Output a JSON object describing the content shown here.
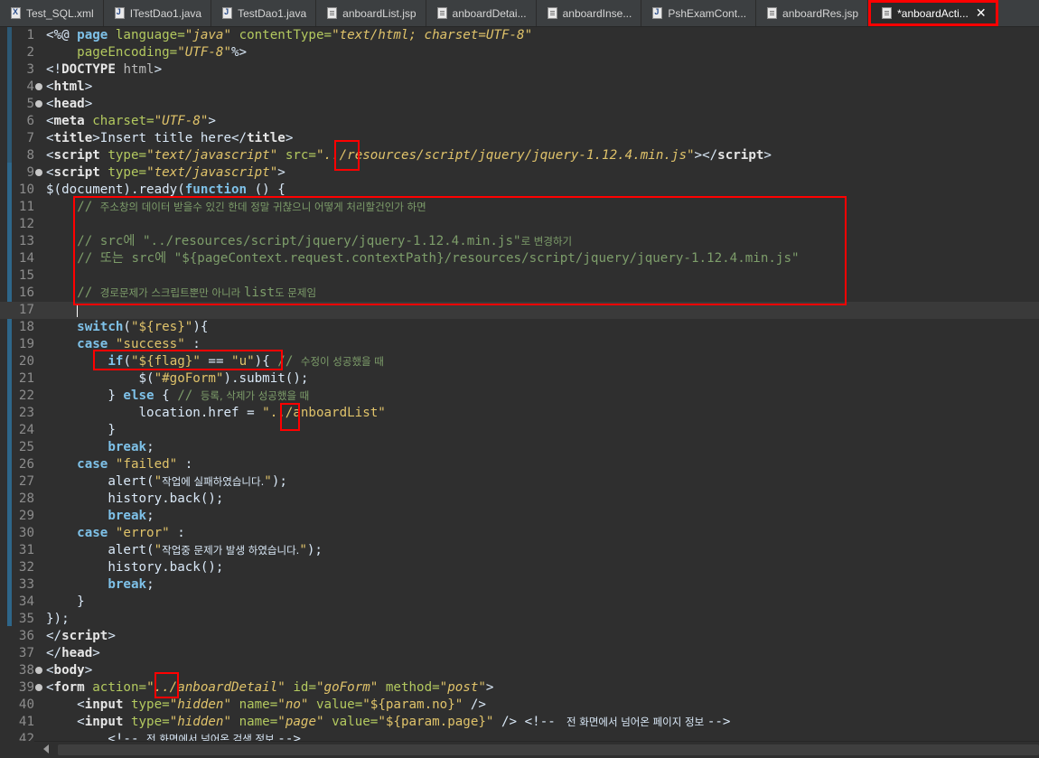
{
  "tabs": [
    {
      "label": "Test_SQL.xml",
      "icon": "xml-file-icon"
    },
    {
      "label": "ITestDao1.java",
      "icon": "java-file-icon"
    },
    {
      "label": "TestDao1.java",
      "icon": "java-file-icon"
    },
    {
      "label": "anboardList.jsp",
      "icon": "jsp-file-icon"
    },
    {
      "label": "anboardDetai...",
      "icon": "jsp-file-icon"
    },
    {
      "label": "anboardInse...",
      "icon": "jsp-file-icon"
    },
    {
      "label": "PshExamCont...",
      "icon": "java-file-icon"
    },
    {
      "label": "anboardRes.jsp",
      "icon": "jsp-file-icon"
    },
    {
      "label": "*anboardActi...",
      "icon": "jsp-file-icon",
      "active": true,
      "close": "✕"
    }
  ],
  "editor": {
    "cursor_line": 17,
    "lines": [
      {
        "n": "1",
        "fold": false,
        "parts": [
          [
            "t",
            "<%@ "
          ],
          [
            "kw",
            "page "
          ],
          [
            "at",
            "language="
          ],
          [
            "av",
            "\"java\" "
          ],
          [
            "at",
            "contentType="
          ],
          [
            "av",
            "\"text/html; charset=UTF-8\""
          ]
        ]
      },
      {
        "n": "2",
        "fold": false,
        "parts": [
          [
            "t",
            "    "
          ],
          [
            "at",
            "pageEncoding="
          ],
          [
            "av",
            "\"UTF-8\""
          ],
          [
            "t",
            "%>"
          ]
        ]
      },
      {
        "n": "3",
        "fold": false,
        "parts": [
          [
            "t",
            "<!"
          ],
          [
            "tag",
            "DOCTYPE "
          ],
          [
            "htc",
            "html"
          ],
          [
            "t",
            ">"
          ]
        ]
      },
      {
        "n": "4",
        "fold": true,
        "parts": [
          [
            "t",
            "<"
          ],
          [
            "tag",
            "html"
          ],
          [
            "t",
            ">"
          ]
        ]
      },
      {
        "n": "5",
        "fold": true,
        "parts": [
          [
            "t",
            "<"
          ],
          [
            "tag",
            "head"
          ],
          [
            "t",
            ">"
          ]
        ]
      },
      {
        "n": "6",
        "fold": false,
        "parts": [
          [
            "t",
            "<"
          ],
          [
            "tag",
            "meta "
          ],
          [
            "at",
            "charset="
          ],
          [
            "av",
            "\"UTF-8\""
          ],
          [
            "t",
            ">"
          ]
        ]
      },
      {
        "n": "7",
        "fold": false,
        "parts": [
          [
            "t",
            "<"
          ],
          [
            "tag",
            "title"
          ],
          [
            "t",
            ">Insert title here</"
          ],
          [
            "tag",
            "title"
          ],
          [
            "t",
            ">"
          ]
        ]
      },
      {
        "n": "8",
        "fold": false,
        "parts": [
          [
            "t",
            "<"
          ],
          [
            "tag",
            "script "
          ],
          [
            "at",
            "type="
          ],
          [
            "av",
            "\"text/javascript\" "
          ],
          [
            "at",
            "src="
          ],
          [
            "av",
            "\"../resources/script/jquery/jquery-1.12.4.min.js\""
          ],
          [
            "t",
            "></"
          ],
          [
            "tag",
            "script"
          ],
          [
            "t",
            ">"
          ]
        ]
      },
      {
        "n": "9",
        "fold": true,
        "parts": [
          [
            "t",
            "<"
          ],
          [
            "tag",
            "script "
          ],
          [
            "at",
            "type="
          ],
          [
            "av",
            "\"text/javascript\""
          ],
          [
            "t",
            ">"
          ]
        ]
      },
      {
        "n": "10",
        "fold": false,
        "parts": [
          [
            "t",
            "$(document).ready("
          ],
          [
            "kw",
            "function"
          ],
          [
            "t",
            " () {"
          ]
        ]
      },
      {
        "n": "11",
        "fold": false,
        "parts": [
          [
            "t",
            "    "
          ],
          [
            "cm",
            "// "
          ],
          [
            "cmk",
            "주소창의 데이터 받을수 있긴 한데 정말 귀찮으니 어떻게 처리할건인가 하면"
          ]
        ]
      },
      {
        "n": "12",
        "fold": false,
        "parts": []
      },
      {
        "n": "13",
        "fold": false,
        "parts": [
          [
            "t",
            "    "
          ],
          [
            "cm",
            "// src에 \"../resources/script/jquery/jquery-1.12.4.min.js\""
          ],
          [
            "cmk",
            "로 변경하기"
          ]
        ]
      },
      {
        "n": "14",
        "fold": false,
        "parts": [
          [
            "t",
            "    "
          ],
          [
            "cm",
            "// 또는 src에 \"${pageContext.request.contextPath}/resources/script/jquery/jquery-1.12.4.min.js\""
          ]
        ]
      },
      {
        "n": "15",
        "fold": false,
        "parts": []
      },
      {
        "n": "16",
        "fold": false,
        "parts": [
          [
            "t",
            "    "
          ],
          [
            "cm",
            "// "
          ],
          [
            "cmk",
            "경로문제가 스크립트뿐만 아니라 "
          ],
          [
            "cm",
            "list"
          ],
          [
            "cmk",
            "도 문제임"
          ]
        ]
      },
      {
        "n": "17",
        "fold": false,
        "parts": [
          [
            "t",
            "    "
          ],
          [
            "cursor",
            ""
          ]
        ]
      },
      {
        "n": "18",
        "fold": false,
        "parts": [
          [
            "t",
            "    "
          ],
          [
            "kw",
            "switch"
          ],
          [
            "t",
            "("
          ],
          [
            "st",
            "\"${res}\""
          ],
          [
            "t",
            "){"
          ]
        ]
      },
      {
        "n": "19",
        "fold": false,
        "parts": [
          [
            "t",
            "    "
          ],
          [
            "kw",
            "case "
          ],
          [
            "st",
            "\"success\""
          ],
          [
            "t",
            " :"
          ]
        ]
      },
      {
        "n": "20",
        "fold": false,
        "parts": [
          [
            "t",
            "        "
          ],
          [
            "kw",
            "if"
          ],
          [
            "t",
            "("
          ],
          [
            "st",
            "\"${flag}\""
          ],
          [
            "t",
            " == "
          ],
          [
            "st",
            "\"u\""
          ],
          [
            "t",
            "){ "
          ],
          [
            "cm",
            "// "
          ],
          [
            "cmk",
            "수정이 성공했을 때"
          ]
        ]
      },
      {
        "n": "21",
        "fold": false,
        "parts": [
          [
            "t",
            "            $("
          ],
          [
            "st",
            "\"#goForm\""
          ],
          [
            "t",
            ").submit();"
          ]
        ]
      },
      {
        "n": "22",
        "fold": false,
        "parts": [
          [
            "t",
            "        } "
          ],
          [
            "kw",
            "else"
          ],
          [
            "t",
            " { "
          ],
          [
            "cm",
            "// "
          ],
          [
            "cmk",
            "등록, 삭제가 성공했을 때"
          ]
        ]
      },
      {
        "n": "23",
        "fold": false,
        "parts": [
          [
            "t",
            "            location.href = "
          ],
          [
            "st",
            "\"../anboardList\""
          ]
        ]
      },
      {
        "n": "24",
        "fold": false,
        "parts": [
          [
            "t",
            "        }"
          ]
        ]
      },
      {
        "n": "25",
        "fold": false,
        "parts": [
          [
            "t",
            "        "
          ],
          [
            "kw",
            "break"
          ],
          [
            "t",
            ";"
          ]
        ]
      },
      {
        "n": "26",
        "fold": false,
        "parts": [
          [
            "t",
            "    "
          ],
          [
            "kw",
            "case "
          ],
          [
            "st",
            "\"failed\""
          ],
          [
            "t",
            " :"
          ]
        ]
      },
      {
        "n": "27",
        "fold": false,
        "parts": [
          [
            "t",
            "        alert("
          ],
          [
            "st",
            "\""
          ],
          [
            "ko",
            "작업에 실패하였습니다."
          ],
          [
            "st",
            "\""
          ],
          [
            "t",
            ");"
          ]
        ]
      },
      {
        "n": "28",
        "fold": false,
        "parts": [
          [
            "t",
            "        history.back();"
          ]
        ]
      },
      {
        "n": "29",
        "fold": false,
        "parts": [
          [
            "t",
            "        "
          ],
          [
            "kw",
            "break"
          ],
          [
            "t",
            ";"
          ]
        ]
      },
      {
        "n": "30",
        "fold": false,
        "parts": [
          [
            "t",
            "    "
          ],
          [
            "kw",
            "case "
          ],
          [
            "st",
            "\"error\""
          ],
          [
            "t",
            " :"
          ]
        ]
      },
      {
        "n": "31",
        "fold": false,
        "parts": [
          [
            "t",
            "        alert("
          ],
          [
            "st",
            "\""
          ],
          [
            "ko",
            "작업중 문제가 발생 하였습니다."
          ],
          [
            "st",
            "\""
          ],
          [
            "t",
            ");"
          ]
        ]
      },
      {
        "n": "32",
        "fold": false,
        "parts": [
          [
            "t",
            "        history.back();"
          ]
        ]
      },
      {
        "n": "33",
        "fold": false,
        "parts": [
          [
            "t",
            "        "
          ],
          [
            "kw",
            "break"
          ],
          [
            "t",
            ";"
          ]
        ]
      },
      {
        "n": "34",
        "fold": false,
        "parts": [
          [
            "t",
            "    }"
          ]
        ]
      },
      {
        "n": "35",
        "fold": false,
        "parts": [
          [
            "t",
            "});"
          ]
        ]
      },
      {
        "n": "36",
        "fold": false,
        "parts": [
          [
            "t",
            "</"
          ],
          [
            "tag",
            "script"
          ],
          [
            "t",
            ">"
          ]
        ]
      },
      {
        "n": "37",
        "fold": false,
        "parts": [
          [
            "t",
            "</"
          ],
          [
            "tag",
            "head"
          ],
          [
            "t",
            ">"
          ]
        ]
      },
      {
        "n": "38",
        "fold": true,
        "parts": [
          [
            "t",
            "<"
          ],
          [
            "tag",
            "body"
          ],
          [
            "t",
            ">"
          ]
        ]
      },
      {
        "n": "39",
        "fold": true,
        "parts": [
          [
            "t",
            "<"
          ],
          [
            "tag",
            "form "
          ],
          [
            "at",
            "action="
          ],
          [
            "av",
            "\"../anboardDetail\" "
          ],
          [
            "at",
            "id="
          ],
          [
            "av",
            "\"goForm\" "
          ],
          [
            "at",
            "method="
          ],
          [
            "av",
            "\"post\""
          ],
          [
            "t",
            ">"
          ]
        ]
      },
      {
        "n": "40",
        "fold": false,
        "parts": [
          [
            "t",
            "    <"
          ],
          [
            "tag",
            "input "
          ],
          [
            "at",
            "type="
          ],
          [
            "av",
            "\"hidden\" "
          ],
          [
            "at",
            "name="
          ],
          [
            "av",
            "\"no\" "
          ],
          [
            "at",
            "value="
          ],
          [
            "st",
            "\"${param.no}\""
          ],
          [
            "t",
            " />"
          ]
        ]
      },
      {
        "n": "41",
        "fold": false,
        "parts": [
          [
            "t",
            "    <"
          ],
          [
            "tag",
            "input "
          ],
          [
            "at",
            "type="
          ],
          [
            "av",
            "\"hidden\" "
          ],
          [
            "at",
            "name="
          ],
          [
            "av",
            "\"page\" "
          ],
          [
            "at",
            "value="
          ],
          [
            "st",
            "\"${param.page}\""
          ],
          [
            "t",
            " /> "
          ],
          [
            "t",
            "<!-- "
          ],
          [
            "ko",
            " 전 화면에서 넘어온 페이지 정보 "
          ],
          [
            "t",
            "-->"
          ]
        ]
      },
      {
        "n": "42",
        "fold": false,
        "parts": [
          [
            "t",
            "        <!-- "
          ],
          [
            "ko",
            "전 화면에서 넘어온 검색 정보 "
          ],
          [
            "t",
            "-->"
          ]
        ]
      }
    ]
  }
}
